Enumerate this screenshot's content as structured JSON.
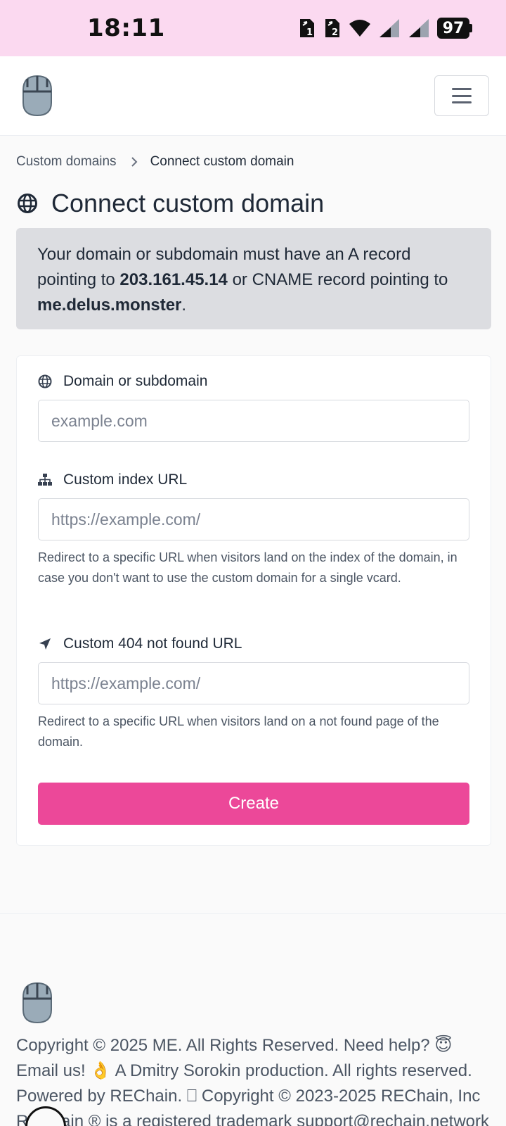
{
  "status_bar": {
    "time": "18:11",
    "battery": "97",
    "icons": [
      "sim1-icon",
      "sim2-icon",
      "wifi-icon",
      "signal-icon",
      "signal-icon",
      "battery-icon"
    ]
  },
  "header": {
    "logo": "mouse-logo",
    "menu_icon": "hamburger-icon"
  },
  "breadcrumb": {
    "parent": "Custom domains",
    "current": "Connect custom domain"
  },
  "page": {
    "title": "Connect custom domain",
    "alert": {
      "text_1": "Your domain or subdomain must have an A record pointing to ",
      "ip": "203.161.45.14",
      "text_2": " or CNAME record pointing to ",
      "cname": "me.delus.monster",
      "text_3": "."
    }
  },
  "form": {
    "domain": {
      "label": "Domain or subdomain",
      "placeholder": "example.com",
      "value": ""
    },
    "index_url": {
      "label": "Custom index URL",
      "placeholder": "https://example.com/",
      "value": "",
      "help": "Redirect to a specific URL when visitors land on the index of the domain, in case you don't want to use the custom domain for a single vcard."
    },
    "not_found_url": {
      "label": "Custom 404 not found URL",
      "placeholder": "https://example.com/",
      "value": "",
      "help": "Redirect to a specific URL when visitors land on a not found page of the domain."
    },
    "submit_label": "Create"
  },
  "footer": {
    "line_1": "Copyright © 2025 ME. All Rights Reserved. Need help? 😇",
    "line_2": "Email us! 👌 A Dmitry Sorokin production. All rights reserved.",
    "line_3": "Powered by REChain. ⎕ Copyright © 2023-2025 REChain, Inc",
    "line_4": "REChain ® is a registered trademark support@rechain.network"
  },
  "colors": {
    "status_bar": "#fbd9f0",
    "accent": "#ec4899",
    "alert_bg": "#dcdde1"
  }
}
